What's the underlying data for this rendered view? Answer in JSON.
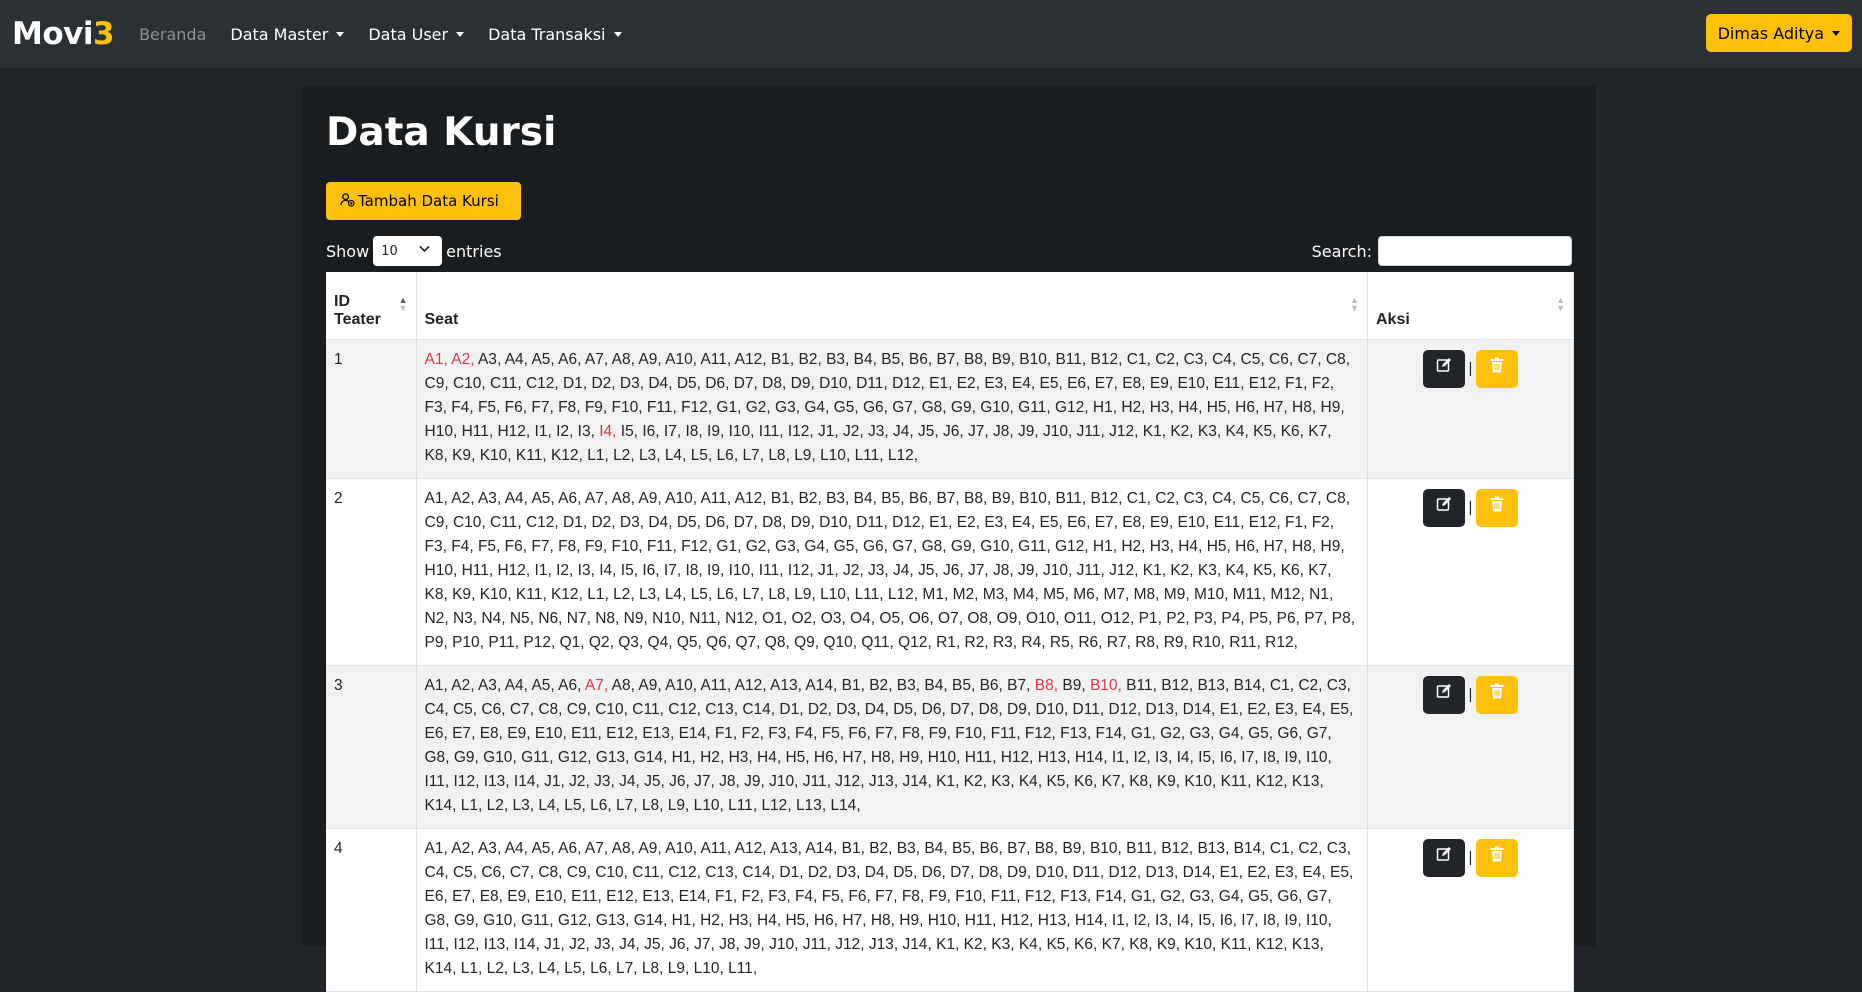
{
  "navbar": {
    "brand_main": "Movi",
    "brand_accent": "3",
    "items": [
      {
        "label": "Beranda",
        "muted": true,
        "dropdown": false
      },
      {
        "label": "Data Master",
        "muted": false,
        "dropdown": true
      },
      {
        "label": "Data User",
        "muted": false,
        "dropdown": true
      },
      {
        "label": "Data Transaksi",
        "muted": false,
        "dropdown": true
      }
    ],
    "user_label": "Dimas Aditya"
  },
  "page": {
    "title": "Data Kursi",
    "add_button_label": "Tambah Data Kursi"
  },
  "table_controls": {
    "show_label": "Show",
    "entries_value": "10",
    "entries_label": "entries",
    "search_label": "Search:",
    "search_value": ""
  },
  "table": {
    "headers": [
      "ID Teater",
      "Seat",
      "Aksi"
    ],
    "rows": [
      {
        "id": "1",
        "booked": [
          "A1",
          "A2",
          "I4"
        ],
        "seats": [
          "A1",
          "A2",
          "A3",
          "A4",
          "A5",
          "A6",
          "A7",
          "A8",
          "A9",
          "A10",
          "A11",
          "A12",
          "B1",
          "B2",
          "B3",
          "B4",
          "B5",
          "B6",
          "B7",
          "B8",
          "B9",
          "B10",
          "B11",
          "B12",
          "C1",
          "C2",
          "C3",
          "C4",
          "C5",
          "C6",
          "C7",
          "C8",
          "C9",
          "C10",
          "C11",
          "C12",
          "D1",
          "D2",
          "D3",
          "D4",
          "D5",
          "D6",
          "D7",
          "D8",
          "D9",
          "D10",
          "D11",
          "D12",
          "E1",
          "E2",
          "E3",
          "E4",
          "E5",
          "E6",
          "E7",
          "E8",
          "E9",
          "E10",
          "E11",
          "E12",
          "F1",
          "F2",
          "F3",
          "F4",
          "F5",
          "F6",
          "F7",
          "F8",
          "F9",
          "F10",
          "F11",
          "F12",
          "G1",
          "G2",
          "G3",
          "G4",
          "G5",
          "G6",
          "G7",
          "G8",
          "G9",
          "G10",
          "G11",
          "G12",
          "H1",
          "H2",
          "H3",
          "H4",
          "H5",
          "H6",
          "H7",
          "H8",
          "H9",
          "H10",
          "H11",
          "H12",
          "I1",
          "I2",
          "I3",
          "I4",
          "I5",
          "I6",
          "I7",
          "I8",
          "I9",
          "I10",
          "I11",
          "I12",
          "J1",
          "J2",
          "J3",
          "J4",
          "J5",
          "J6",
          "J7",
          "J8",
          "J9",
          "J10",
          "J11",
          "J12",
          "K1",
          "K2",
          "K3",
          "K4",
          "K5",
          "K6",
          "K7",
          "K8",
          "K9",
          "K10",
          "K11",
          "K12",
          "L1",
          "L2",
          "L3",
          "L4",
          "L5",
          "L6",
          "L7",
          "L8",
          "L9",
          "L10",
          "L11",
          "L12"
        ]
      },
      {
        "id": "2",
        "booked": [],
        "seats": [
          "A1",
          "A2",
          "A3",
          "A4",
          "A5",
          "A6",
          "A7",
          "A8",
          "A9",
          "A10",
          "A11",
          "A12",
          "B1",
          "B2",
          "B3",
          "B4",
          "B5",
          "B6",
          "B7",
          "B8",
          "B9",
          "B10",
          "B11",
          "B12",
          "C1",
          "C2",
          "C3",
          "C4",
          "C5",
          "C6",
          "C7",
          "C8",
          "C9",
          "C10",
          "C11",
          "C12",
          "D1",
          "D2",
          "D3",
          "D4",
          "D5",
          "D6",
          "D7",
          "D8",
          "D9",
          "D10",
          "D11",
          "D12",
          "E1",
          "E2",
          "E3",
          "E4",
          "E5",
          "E6",
          "E7",
          "E8",
          "E9",
          "E10",
          "E11",
          "E12",
          "F1",
          "F2",
          "F3",
          "F4",
          "F5",
          "F6",
          "F7",
          "F8",
          "F9",
          "F10",
          "F11",
          "F12",
          "G1",
          "G2",
          "G3",
          "G4",
          "G5",
          "G6",
          "G7",
          "G8",
          "G9",
          "G10",
          "G11",
          "G12",
          "H1",
          "H2",
          "H3",
          "H4",
          "H5",
          "H6",
          "H7",
          "H8",
          "H9",
          "H10",
          "H11",
          "H12",
          "I1",
          "I2",
          "I3",
          "I4",
          "I5",
          "I6",
          "I7",
          "I8",
          "I9",
          "I10",
          "I11",
          "I12",
          "J1",
          "J2",
          "J3",
          "J4",
          "J5",
          "J6",
          "J7",
          "J8",
          "J9",
          "J10",
          "J11",
          "J12",
          "K1",
          "K2",
          "K3",
          "K4",
          "K5",
          "K6",
          "K7",
          "K8",
          "K9",
          "K10",
          "K11",
          "K12",
          "L1",
          "L2",
          "L3",
          "L4",
          "L5",
          "L6",
          "L7",
          "L8",
          "L9",
          "L10",
          "L11",
          "L12",
          "M1",
          "M2",
          "M3",
          "M4",
          "M5",
          "M6",
          "M7",
          "M8",
          "M9",
          "M10",
          "M11",
          "M12",
          "N1",
          "N2",
          "N3",
          "N4",
          "N5",
          "N6",
          "N7",
          "N8",
          "N9",
          "N10",
          "N11",
          "N12",
          "O1",
          "O2",
          "O3",
          "O4",
          "O5",
          "O6",
          "O7",
          "O8",
          "O9",
          "O10",
          "O11",
          "O12",
          "P1",
          "P2",
          "P3",
          "P4",
          "P5",
          "P6",
          "P7",
          "P8",
          "P9",
          "P10",
          "P11",
          "P12",
          "Q1",
          "Q2",
          "Q3",
          "Q4",
          "Q5",
          "Q6",
          "Q7",
          "Q8",
          "Q9",
          "Q10",
          "Q11",
          "Q12",
          "R1",
          "R2",
          "R3",
          "R4",
          "R5",
          "R6",
          "R7",
          "R8",
          "R9",
          "R10",
          "R11",
          "R12"
        ]
      },
      {
        "id": "3",
        "booked": [
          "A7",
          "B8",
          "B10"
        ],
        "seats": [
          "A1",
          "A2",
          "A3",
          "A4",
          "A5",
          "A6",
          "A7",
          "A8",
          "A9",
          "A10",
          "A11",
          "A12",
          "A13",
          "A14",
          "B1",
          "B2",
          "B3",
          "B4",
          "B5",
          "B6",
          "B7",
          "B8",
          "B9",
          "B10",
          "B11",
          "B12",
          "B13",
          "B14",
          "C1",
          "C2",
          "C3",
          "C4",
          "C5",
          "C6",
          "C7",
          "C8",
          "C9",
          "C10",
          "C11",
          "C12",
          "C13",
          "C14",
          "D1",
          "D2",
          "D3",
          "D4",
          "D5",
          "D6",
          "D7",
          "D8",
          "D9",
          "D10",
          "D11",
          "D12",
          "D13",
          "D14",
          "E1",
          "E2",
          "E3",
          "E4",
          "E5",
          "E6",
          "E7",
          "E8",
          "E9",
          "E10",
          "E11",
          "E12",
          "E13",
          "E14",
          "F1",
          "F2",
          "F3",
          "F4",
          "F5",
          "F6",
          "F7",
          "F8",
          "F9",
          "F10",
          "F11",
          "F12",
          "F13",
          "F14",
          "G1",
          "G2",
          "G3",
          "G4",
          "G5",
          "G6",
          "G7",
          "G8",
          "G9",
          "G10",
          "G11",
          "G12",
          "G13",
          "G14",
          "H1",
          "H2",
          "H3",
          "H4",
          "H5",
          "H6",
          "H7",
          "H8",
          "H9",
          "H10",
          "H11",
          "H12",
          "H13",
          "H14",
          "I1",
          "I2",
          "I3",
          "I4",
          "I5",
          "I6",
          "I7",
          "I8",
          "I9",
          "I10",
          "I11",
          "I12",
          "I13",
          "I14",
          "J1",
          "J2",
          "J3",
          "J4",
          "J5",
          "J6",
          "J7",
          "J8",
          "J9",
          "J10",
          "J11",
          "J12",
          "J13",
          "J14",
          "K1",
          "K2",
          "K3",
          "K4",
          "K5",
          "K6",
          "K7",
          "K8",
          "K9",
          "K10",
          "K11",
          "K12",
          "K13",
          "K14",
          "L1",
          "L2",
          "L3",
          "L4",
          "L5",
          "L6",
          "L7",
          "L8",
          "L9",
          "L10",
          "L11",
          "L12",
          "L13",
          "L14"
        ]
      },
      {
        "id": "4",
        "booked": [],
        "seats": [
          "A1",
          "A2",
          "A3",
          "A4",
          "A5",
          "A6",
          "A7",
          "A8",
          "A9",
          "A10",
          "A11",
          "A12",
          "A13",
          "A14",
          "B1",
          "B2",
          "B3",
          "B4",
          "B5",
          "B6",
          "B7",
          "B8",
          "B9",
          "B10",
          "B11",
          "B12",
          "B13",
          "B14",
          "C1",
          "C2",
          "C3",
          "C4",
          "C5",
          "C6",
          "C7",
          "C8",
          "C9",
          "C10",
          "C11",
          "C12",
          "C13",
          "C14",
          "D1",
          "D2",
          "D3",
          "D4",
          "D5",
          "D6",
          "D7",
          "D8",
          "D9",
          "D10",
          "D11",
          "D12",
          "D13",
          "D14",
          "E1",
          "E2",
          "E3",
          "E4",
          "E5",
          "E6",
          "E7",
          "E8",
          "E9",
          "E10",
          "E11",
          "E12",
          "E13",
          "E14",
          "F1",
          "F2",
          "F3",
          "F4",
          "F5",
          "F6",
          "F7",
          "F8",
          "F9",
          "F10",
          "F11",
          "F12",
          "F13",
          "F14",
          "G1",
          "G2",
          "G3",
          "G4",
          "G5",
          "G6",
          "G7",
          "G8",
          "G9",
          "G10",
          "G11",
          "G12",
          "G13",
          "G14",
          "H1",
          "H2",
          "H3",
          "H4",
          "H5",
          "H6",
          "H7",
          "H8",
          "H9",
          "H10",
          "H11",
          "H12",
          "H13",
          "H14",
          "I1",
          "I2",
          "I3",
          "I4",
          "I5",
          "I6",
          "I7",
          "I8",
          "I9",
          "I10",
          "I11",
          "I12",
          "I13",
          "I14",
          "J1",
          "J2",
          "J3",
          "J4",
          "J5",
          "J6",
          "J7",
          "J8",
          "J9",
          "J10",
          "J11",
          "J12",
          "J13",
          "J14",
          "K1",
          "K2",
          "K3",
          "K4",
          "K5",
          "K6",
          "K7",
          "K8",
          "K9",
          "K10",
          "K11",
          "K12",
          "K13",
          "K14",
          "L1",
          "L2",
          "L3",
          "L4",
          "L5",
          "L6",
          "L7",
          "L8",
          "L9",
          "L10",
          "L11"
        ]
      }
    ],
    "action_separator": "|"
  },
  "colors": {
    "accent": "#ffc107",
    "booked_seat": "#dc3545",
    "navbar_bg": "#2b3035",
    "page_bg": "#212529"
  },
  "icons": {
    "add": "user-add-icon",
    "edit": "edit-icon",
    "delete": "trash-icon",
    "dropdown": "caret-down-icon",
    "sort": "sort-icon"
  }
}
